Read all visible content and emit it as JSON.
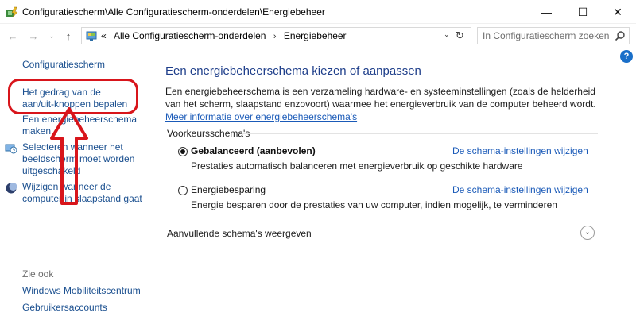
{
  "window": {
    "title": "Configuratiescherm\\Alle Configuratiescherm-onderdelen\\Energiebeheer",
    "controls": {
      "minimize": "—",
      "maximize": "☐",
      "close": "✕"
    }
  },
  "nav": {
    "back": "←",
    "forward": "→",
    "recent": "⌄",
    "up": "↑",
    "breadcrumb_prefix": "«",
    "breadcrumb": [
      "Alle Configuratiescherm-onderdelen",
      "Energiebeheer"
    ],
    "breadcrumb_sep": "›",
    "dropdown": "⌄",
    "refresh": "↻",
    "search_placeholder": "In Configuratiescherm zoeken"
  },
  "help": "?",
  "sidebar": {
    "home": "Configuratiescherm",
    "links": [
      "Het gedrag van de aan/uit-knoppen bepalen",
      "Een energiebeheerschema maken",
      "Selecteren wanneer het beeldscherm moet worden uitgeschakeld",
      "Wijzigen wanneer de computer in slaapstand gaat"
    ],
    "see_also": "Zie ook",
    "see_also_links": [
      "Windows Mobiliteitscentrum",
      "Gebruikersaccounts"
    ]
  },
  "main": {
    "title": "Een energiebeheerschema kiezen of aanpassen",
    "description": "Een energiebeheerschema is een verzameling hardware- en systeeminstellingen (zoals de helderheid van het scherm, slaapstand enzovoort) waarmee het energieverbruik van de computer beheerd wordt.",
    "more_info_link": "Meer informatie over energiebeheerschema's",
    "preferred_label": "Voorkeursschema's",
    "plans": [
      {
        "name": "Gebalanceerd (aanbevolen)",
        "selected": true,
        "link": "De schema-instellingen wijzigen",
        "description": "Prestaties automatisch balanceren met energieverbruik op geschikte hardware"
      },
      {
        "name": "Energiebesparing",
        "selected": false,
        "link": "De schema-instellingen wijzigen",
        "description": "Energie besparen door de prestaties van uw computer, indien mogelijk, te verminderen"
      }
    ],
    "more_plans": "Aanvullende schema's weergeven",
    "expand": "⌄"
  },
  "annotation": {
    "color": "#d8151b"
  }
}
